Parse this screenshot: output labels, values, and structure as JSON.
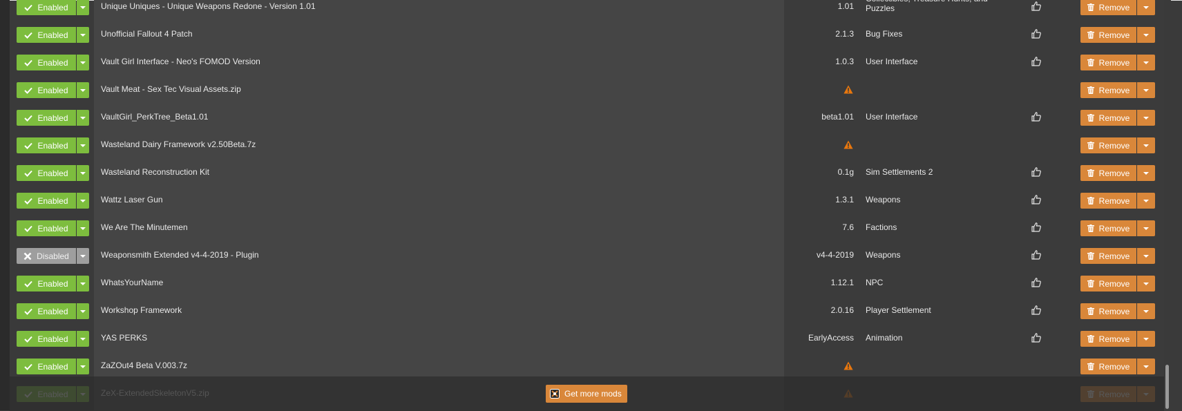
{
  "labels": {
    "enabled": "Enabled",
    "disabled": "Disabled",
    "remove": "Remove",
    "get_more_mods": "Get more mods"
  },
  "colors": {
    "enabled_green": "#7dbd3e",
    "disabled_gray": "#9e9e9e",
    "remove_orange": "#d9873a",
    "warning_orange": "#e8770e"
  },
  "icons": {
    "check": "check-icon",
    "x": "x-icon",
    "dropdown": "chevron-down-icon",
    "warning": "warning-icon",
    "endorse": "thumbs-up-icon",
    "trash": "trash-icon",
    "nexus": "nexus-icon"
  },
  "mods": [
    {
      "name": "Unique Uniques - Unique Weapons Redone - Version 1.01",
      "version": "1.01",
      "category": "Collectibles, Treasure Hunts, and Puzzles",
      "enabled": true,
      "warning": false,
      "endorse": true
    },
    {
      "name": "Unofficial Fallout 4 Patch",
      "version": "2.1.3",
      "category": "Bug Fixes",
      "enabled": true,
      "warning": false,
      "endorse": true
    },
    {
      "name": "Vault Girl Interface - Neo's FOMOD Version",
      "version": "1.0.3",
      "category": "User Interface",
      "enabled": true,
      "warning": false,
      "endorse": true
    },
    {
      "name": "Vault Meat - Sex Tec Visual Assets.zip",
      "version": "",
      "category": "",
      "enabled": true,
      "warning": true,
      "endorse": false
    },
    {
      "name": "VaultGirl_PerkTree_Beta1.01",
      "version": "beta1.01",
      "category": "User Interface",
      "enabled": true,
      "warning": false,
      "endorse": true
    },
    {
      "name": "Wasteland Dairy Framework v2.50Beta.7z",
      "version": "",
      "category": "",
      "enabled": true,
      "warning": true,
      "endorse": false
    },
    {
      "name": "Wasteland Reconstruction Kit",
      "version": "0.1g",
      "category": "Sim Settlements 2",
      "enabled": true,
      "warning": false,
      "endorse": true
    },
    {
      "name": "Wattz Laser Gun",
      "version": "1.3.1",
      "category": "Weapons",
      "enabled": true,
      "warning": false,
      "endorse": true
    },
    {
      "name": "We Are The Minutemen",
      "version": "7.6",
      "category": "Factions",
      "enabled": true,
      "warning": false,
      "endorse": true
    },
    {
      "name": "Weaponsmith Extended v4-4-2019 - Plugin",
      "version": "v4-4-2019",
      "category": "Weapons",
      "enabled": false,
      "warning": false,
      "endorse": true
    },
    {
      "name": "WhatsYourName",
      "version": "1.12.1",
      "category": "NPC",
      "enabled": true,
      "warning": false,
      "endorse": true
    },
    {
      "name": "Workshop Framework",
      "version": "2.0.16",
      "category": "Player Settlement",
      "enabled": true,
      "warning": false,
      "endorse": true
    },
    {
      "name": "YAS PERKS",
      "version": "EarlyAccess",
      "category": "Animation",
      "enabled": true,
      "warning": false,
      "endorse": true
    },
    {
      "name": "ZaZOut4 Beta V.003.7z",
      "version": "",
      "category": "",
      "enabled": true,
      "warning": true,
      "endorse": false
    },
    {
      "name": "ZeX-ExtendedSkeletonV5.zip",
      "version": "",
      "category": "",
      "enabled": true,
      "warning": true,
      "endorse": false
    }
  ]
}
